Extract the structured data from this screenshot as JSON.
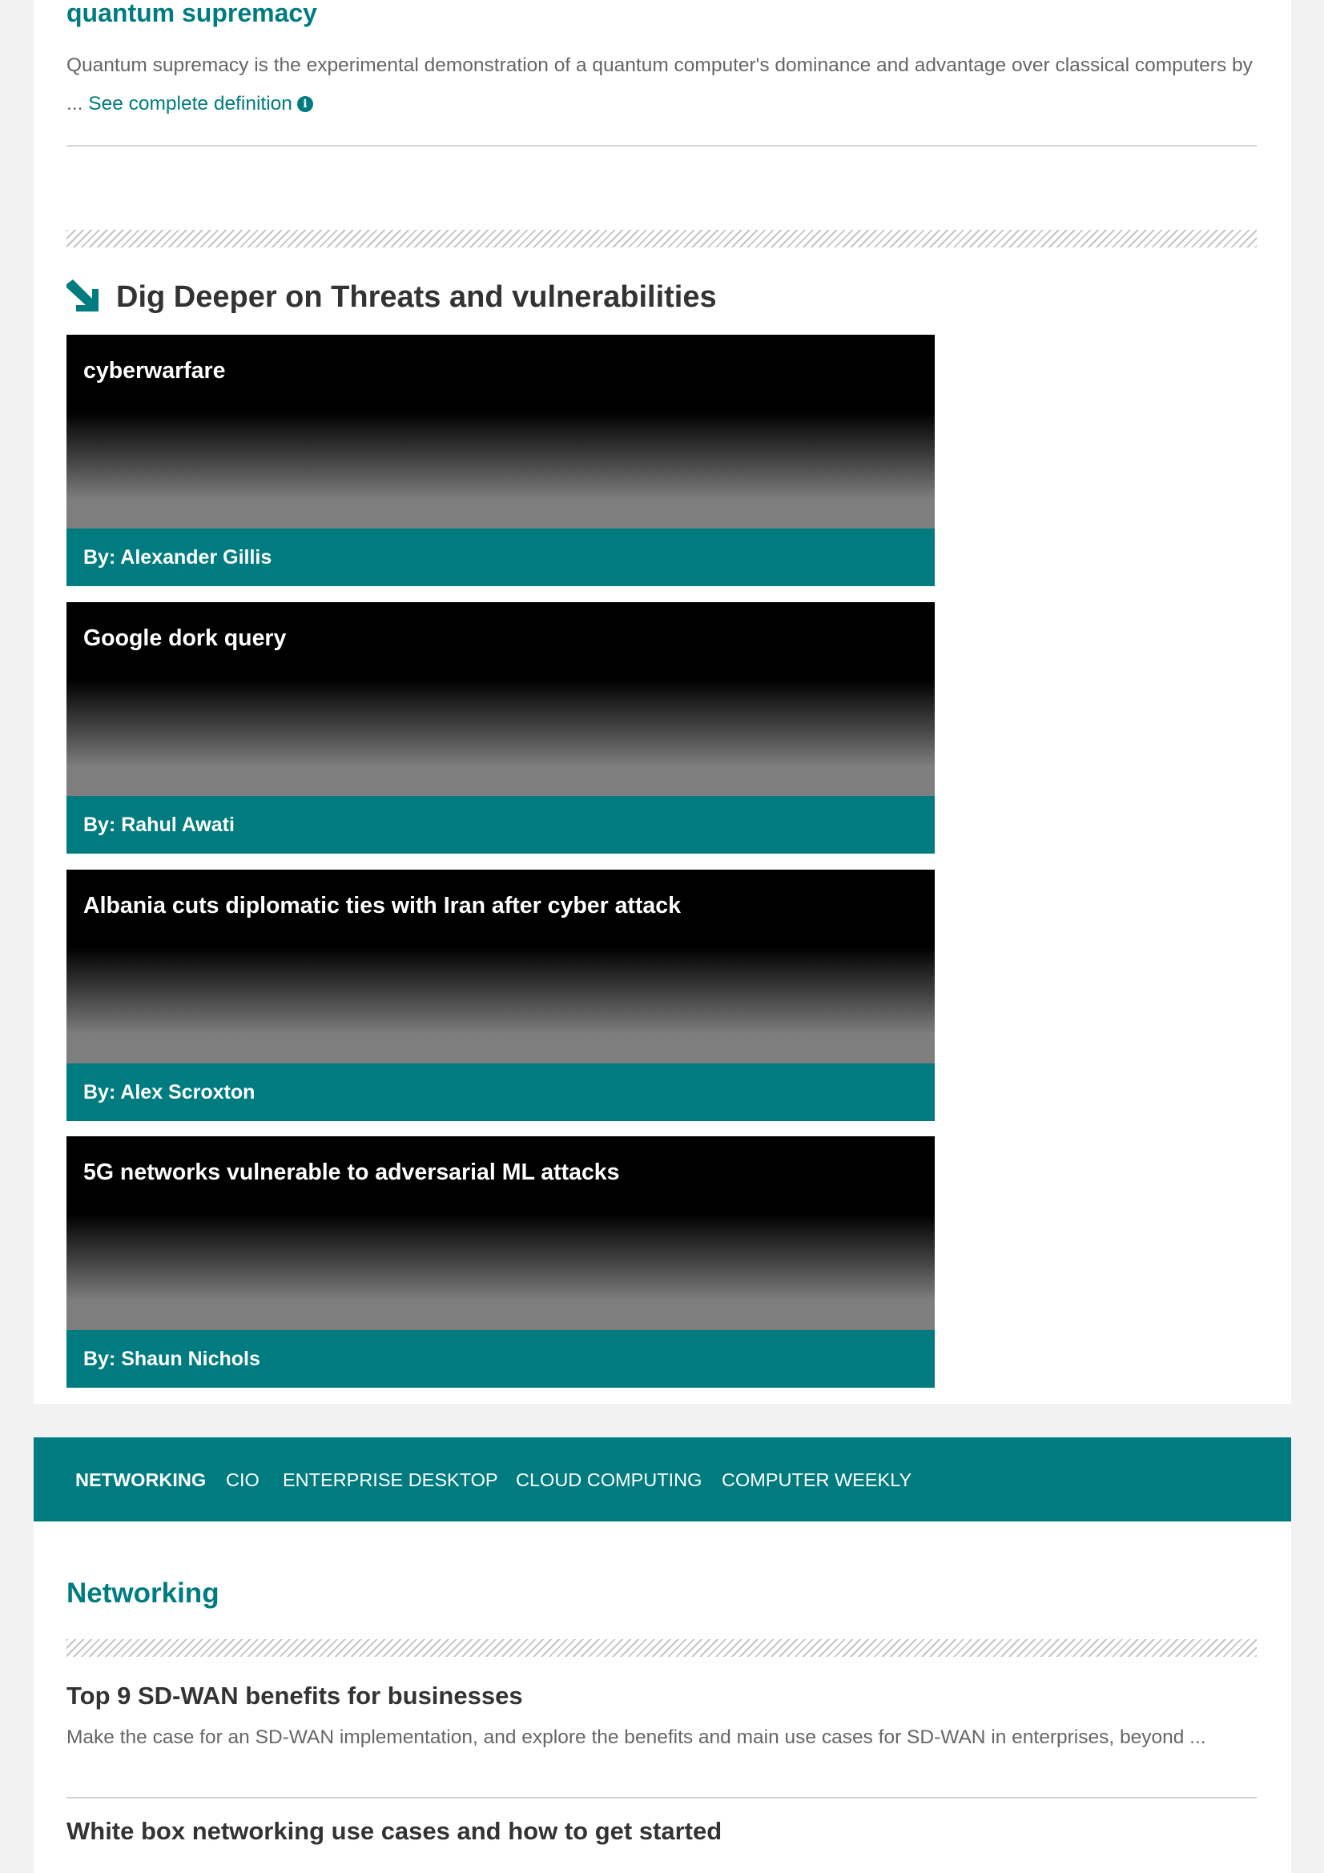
{
  "definition": {
    "title": "quantum supremacy",
    "body": "Quantum supremacy is the experimental demonstration of a quantum computer's dominance and advantage over classical computers by ...",
    "link_label": "See complete definition",
    "info_icon": "i"
  },
  "dig_deeper": {
    "icon": "arrow-down-right-icon",
    "heading": "Dig Deeper on Threats and vulnerabilities",
    "cards": [
      {
        "title": "cyberwarfare",
        "byline": "By: Alexander Gillis"
      },
      {
        "title": "Google dork query",
        "byline": "By: Rahul Awati"
      },
      {
        "title": "Albania cuts diplomatic ties with Iran after cyber attack",
        "byline": "By: Alex Scroxton"
      },
      {
        "title": "5G networks vulnerable to adversarial ML attacks",
        "byline": "By: Shaun Nichols"
      }
    ]
  },
  "network_nav": {
    "items": [
      {
        "label": "NETWORKING",
        "active": true
      },
      {
        "label": "CIO",
        "active": false
      },
      {
        "label": "ENTERPRISE DESKTOP",
        "active": false
      },
      {
        "label": "CLOUD COMPUTING",
        "active": false
      },
      {
        "label": "COMPUTER WEEKLY",
        "active": false
      }
    ]
  },
  "networking_section": {
    "title": "Networking",
    "articles": [
      {
        "title": "Top 9 SD-WAN benefits for businesses",
        "summary": "Make the case for an SD-WAN implementation, and explore the benefits and main use cases for SD-WAN in enterprises, beyond ..."
      },
      {
        "title": "White box networking use cases and how to get started"
      }
    ]
  },
  "colors": {
    "accent": "#007c80",
    "background": "#f2f2f2",
    "heading_text": "#333333",
    "body_text": "#666666"
  }
}
